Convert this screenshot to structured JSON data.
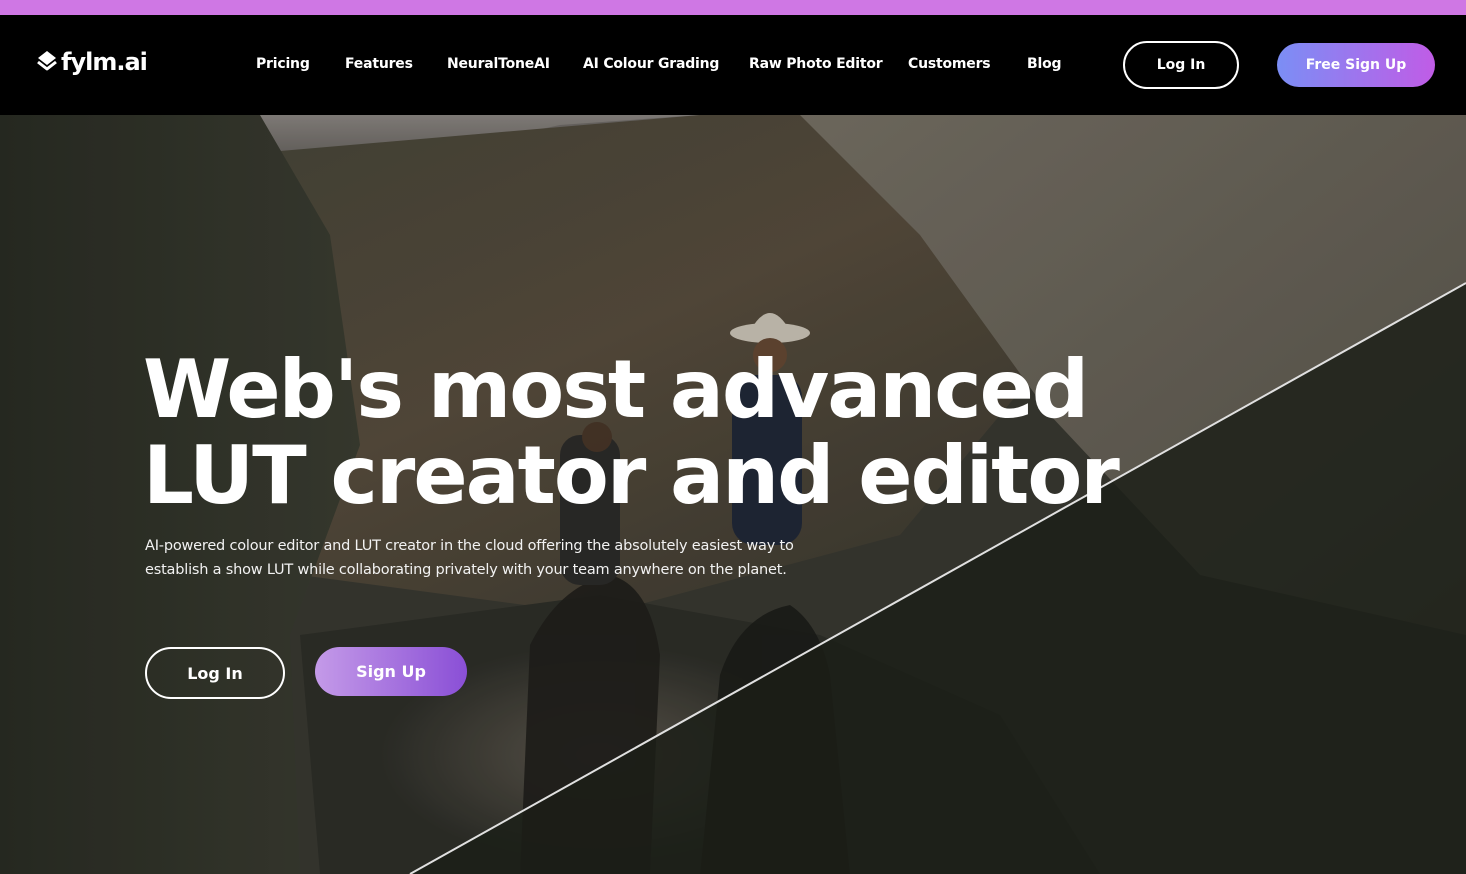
{
  "colors": {
    "top_strip": "#cf77e4",
    "nav_bg": "#000000",
    "gradient_start": "#7b8ef5",
    "gradient_end": "#c05ce6",
    "hero_button_start": "#c49ae8",
    "hero_button_end": "#8a4fd6"
  },
  "brand": {
    "logo_icon": "layered-diamond-icon",
    "name": "fylm.ai"
  },
  "nav": {
    "links": [
      "Pricing",
      "Features",
      "NeuralToneAI",
      "AI Colour Grading",
      "Raw Photo Editor",
      "Customers",
      "Blog"
    ],
    "login_label": "Log In",
    "signup_label": "Free Sign Up"
  },
  "hero": {
    "headline_line1": "Web's most advanced",
    "headline_line2": "LUT creator and editor",
    "subtext_line1": "AI-powered colour editor and LUT creator in the cloud offering the absolutely easiest way to",
    "subtext_line2": "establish a show LUT while collaborating privately with your team anywhere on the planet.",
    "login_label": "Log In",
    "signup_label": "Sign Up"
  }
}
